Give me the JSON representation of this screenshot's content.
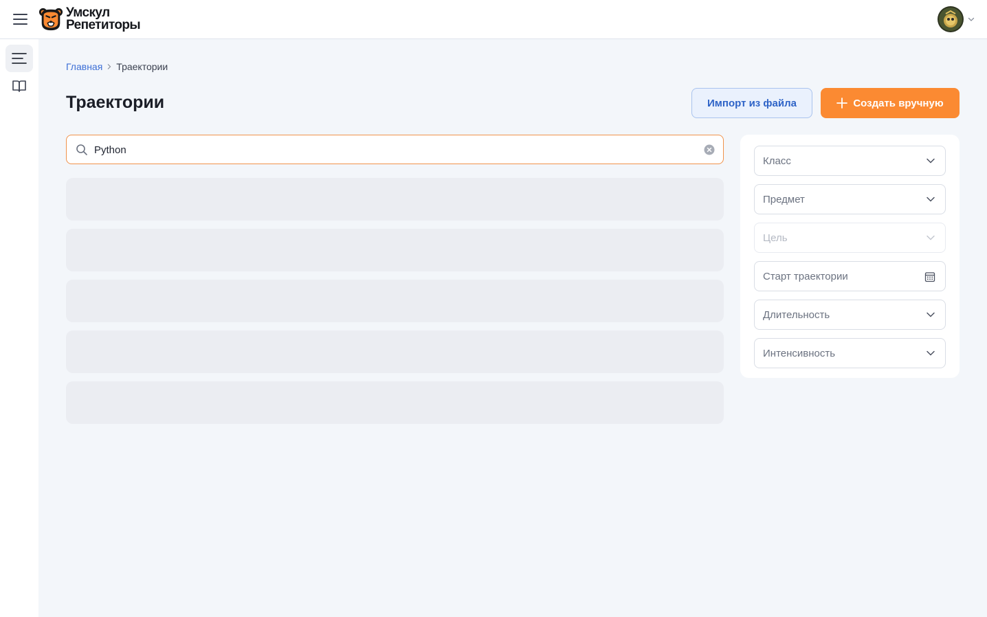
{
  "app": {
    "logo_line1": "Умскул",
    "logo_line2": "Репетиторы",
    "brand_color": "#fb8a32"
  },
  "header": {
    "menu_icon": "hamburger-icon",
    "avatar_icon": "user-avatar",
    "caret_icon": "chevron-down-icon"
  },
  "sidebar": {
    "items": [
      {
        "icon": "list-menu-icon",
        "active": true
      },
      {
        "icon": "book-icon",
        "active": false
      }
    ]
  },
  "breadcrumb": {
    "home": "Главная",
    "current": "Траектории"
  },
  "page": {
    "title": "Траектории",
    "import_label": "Импорт из файла",
    "create_label": "Создать вручную"
  },
  "search": {
    "value": "Python",
    "placeholder": ""
  },
  "filters": {
    "grade": "Класс",
    "subject": "Предмет",
    "goal": "Цель",
    "start": "Старт траектории",
    "duration": "Длительность",
    "intensity": "Интенсивность"
  }
}
